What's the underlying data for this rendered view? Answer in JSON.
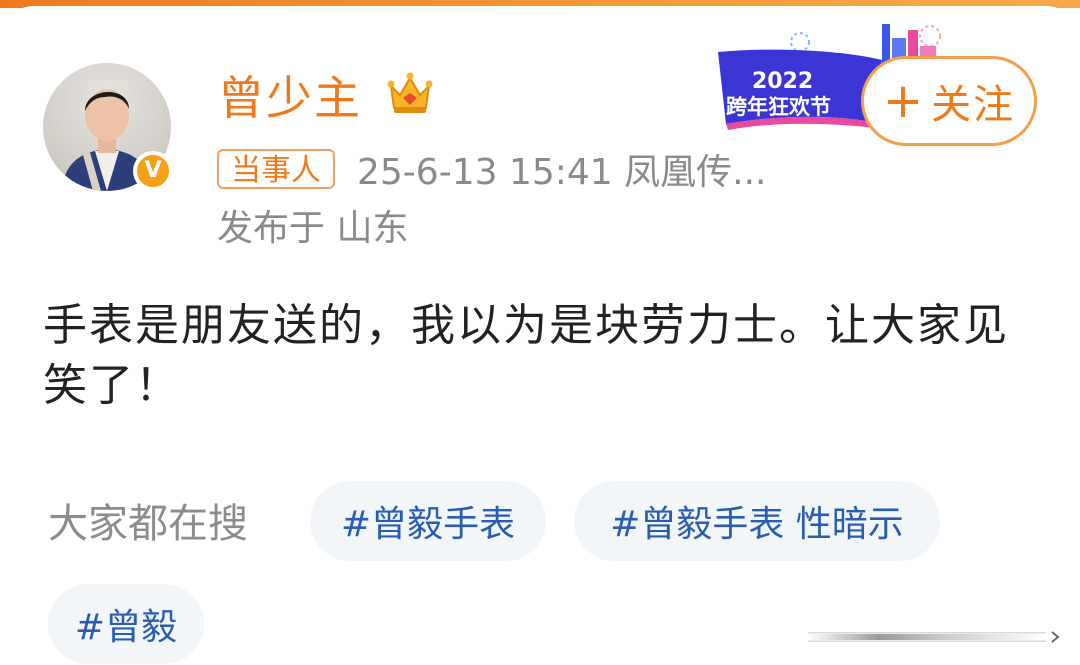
{
  "header": {
    "accent_color": "#f07a1a"
  },
  "post": {
    "username": "曾少主",
    "follow_label": "关注",
    "role_badge": "当事人",
    "meta": "25-6-13 15:41  凤凰传...",
    "location": "发布于 山东",
    "content": "手表是朋友送的，我以为是块劳力士。让大家见笑了！",
    "verified_badge": "V",
    "banner_year": "2022",
    "banner_text": "跨年狂欢节"
  },
  "search": {
    "label": "大家都在搜",
    "chips": [
      "#曾毅手表",
      "#曾毅手表 性暗示",
      "#曾毅"
    ]
  },
  "icons": [
    "crown-icon",
    "verified-icon",
    "plus-icon"
  ]
}
